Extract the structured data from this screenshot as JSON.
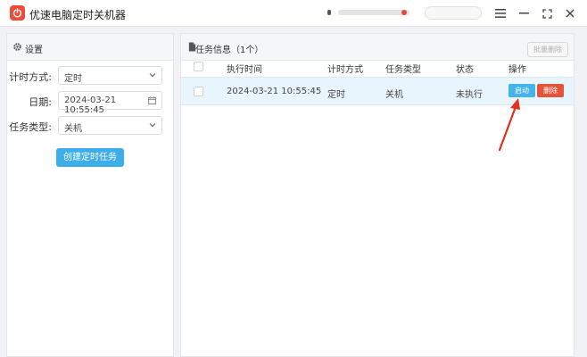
{
  "app": {
    "title": "优速电脑定时关机器"
  },
  "settings": {
    "title": "设置",
    "timing_label": "计时方式:",
    "timing_value": "定时",
    "date_label": "日期:",
    "date_value": "2024-03-21 10:55:45",
    "task_type_label": "任务类型:",
    "task_type_value": "关机",
    "create_button": "创建定时任务"
  },
  "tasks": {
    "title": "任务信息（1个）",
    "batch_delete": "批量删除",
    "columns": [
      "执行时间",
      "计时方式",
      "任务类型",
      "状态",
      "操作"
    ],
    "rows": [
      {
        "time": "2024-03-21 10:55:45",
        "mode": "定时",
        "type": "关机",
        "status": "未执行",
        "start": "启动",
        "delete": "删除"
      }
    ]
  },
  "colors": {
    "accent": "#3daee9",
    "danger": "#e2543b",
    "annotation_arrow": "#e0301e"
  },
  "icons": {
    "logo": "power-icon",
    "settings": "gear-icon",
    "tasks": "document-icon",
    "menu": "hamburger-icon",
    "minimize": "minimize-icon",
    "maximize": "fullscreen-icon",
    "close": "close-icon"
  }
}
